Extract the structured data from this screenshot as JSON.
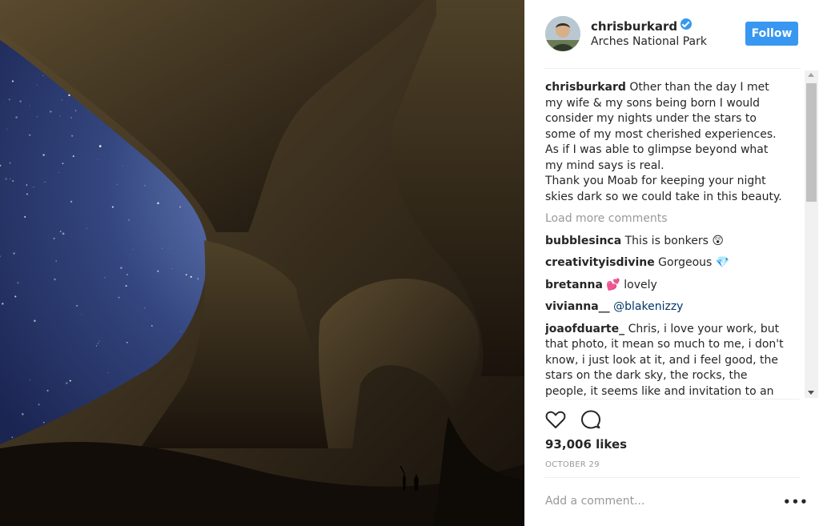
{
  "post": {
    "username": "chrisburkard",
    "location": "Arches National Park",
    "follow_label": "Follow",
    "caption_user": "chrisburkard",
    "caption_text": "Other than the day I met my wife & my sons being born I would consider my nights under the stars to some of my most cherished experiences. As if I was able to glimpse beyond what my mind says is real.\nThank you Moab for keeping your night skies dark so we could take in this beauty.",
    "load_more": "Load more comments",
    "comments": [
      {
        "user": "bubblesinca",
        "text": "This is bonkers 😲"
      },
      {
        "user": "creativityisdivine",
        "text": "Gorgeous 💎"
      },
      {
        "user": "bretanna",
        "text": "💕 lovely"
      },
      {
        "user": "vivianna__",
        "text": "@blakenizzy"
      },
      {
        "user": "joaofduarte_",
        "text": "Chris, i love your work, but that photo, it mean so much to me, i don't know, i just look at it, and i feel good, the stars on the dark sky, the rocks, the people, it seems like and invitation to an"
      }
    ],
    "likes": "93,006 likes",
    "date": "OCTOBER 29",
    "add_comment_placeholder": "Add a comment...",
    "more_label": "•••"
  },
  "colors": {
    "accent": "#3897f0",
    "text": "#262626",
    "muted": "#999999",
    "mention": "#003569"
  },
  "icons": [
    "verified-badge-icon",
    "heart-icon",
    "comment-icon",
    "more-options-icon"
  ]
}
